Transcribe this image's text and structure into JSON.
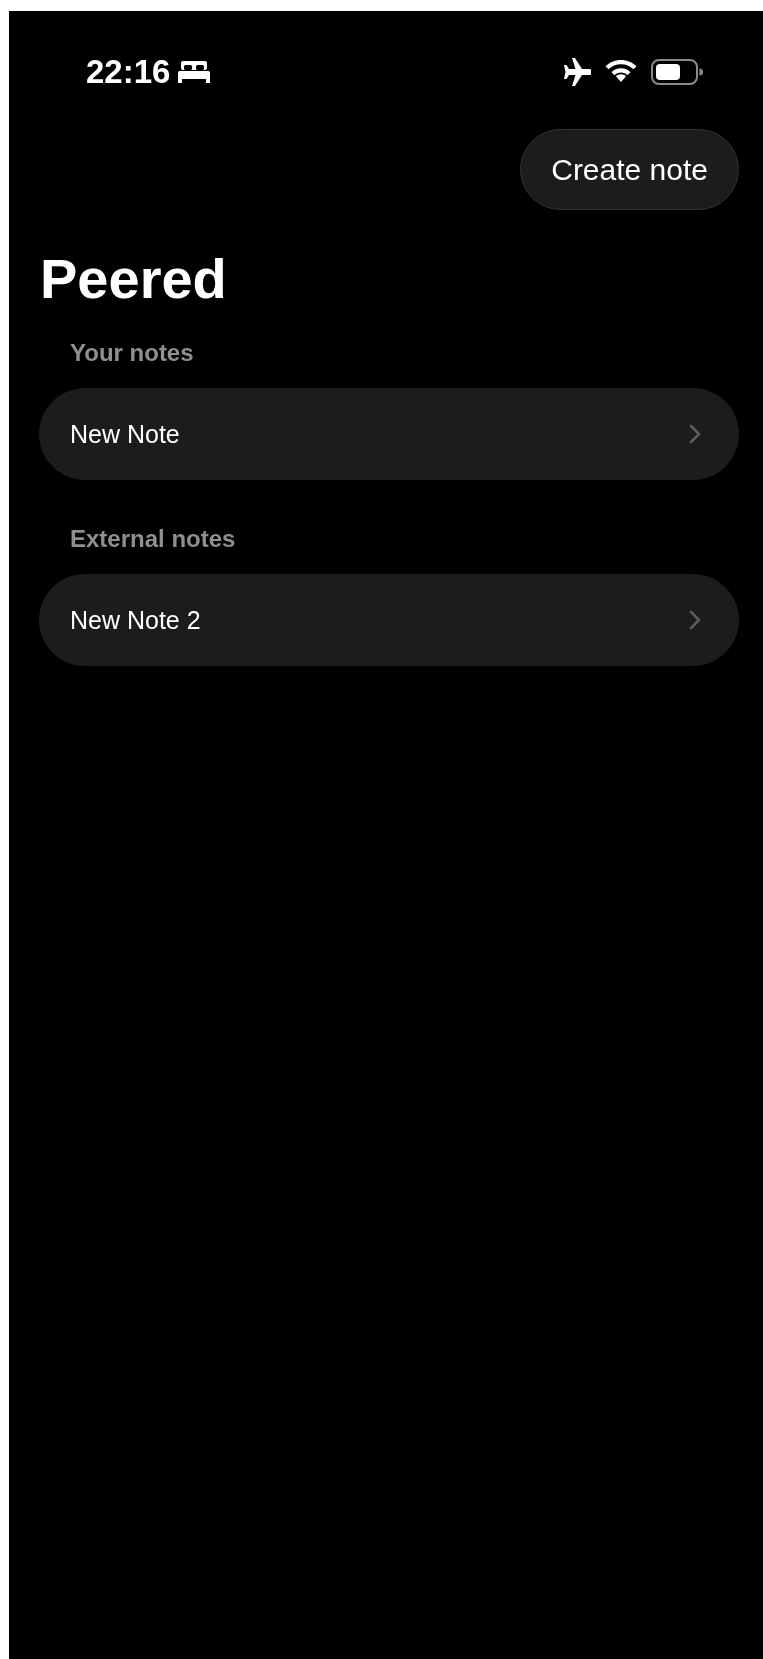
{
  "status_bar": {
    "time": "22:16"
  },
  "toolbar": {
    "button": "Create note"
  },
  "title": "Peered",
  "sections": [
    {
      "heading": "Your notes",
      "notes": [
        {
          "title": "New Note"
        }
      ]
    },
    {
      "heading": "External notes",
      "notes": [
        {
          "title": "New Note 2"
        }
      ]
    }
  ]
}
